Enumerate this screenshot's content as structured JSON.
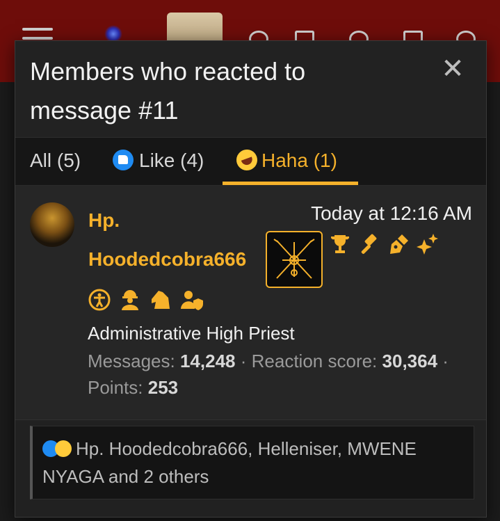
{
  "modal": {
    "title": "Members who reacted to message #11",
    "close_glyph": "✕"
  },
  "tabs": [
    {
      "label": "All (5)",
      "icon": null,
      "active": false
    },
    {
      "label": "Like (4)",
      "icon": "like-reaction-icon",
      "active": false
    },
    {
      "label": "Haha (1)",
      "icon": "haha-reaction-icon",
      "active": true
    }
  ],
  "member": {
    "username": "Hp. Hoodedcobra666",
    "timestamp": "Today at 12:16 AM",
    "role": "Administrative High Priest",
    "stats": {
      "messages_label": "Messages:",
      "messages": "14,248",
      "separator": "·",
      "reaction_label": "Reaction score:",
      "reaction_score": "30,364",
      "points_label": "Points:",
      "points": "253"
    },
    "badges_row1": [
      "trophy-icon",
      "gavel-icon",
      "pen-nib-icon",
      "sparkles-icon"
    ],
    "badges_row2": [
      "accessibility-icon",
      "worker-icon",
      "horse-head-icon",
      "user-shield-icon"
    ]
  },
  "reaction_summary": {
    "text": "Hp. Hoodedcobra666, Helleniser, MWENE NYAGA and 2 others"
  },
  "colors": {
    "accent": "#f5b12b",
    "header_red": "#6e0d0a",
    "like_blue": "#1f8bf2",
    "haha_yellow": "#ffca3a"
  }
}
